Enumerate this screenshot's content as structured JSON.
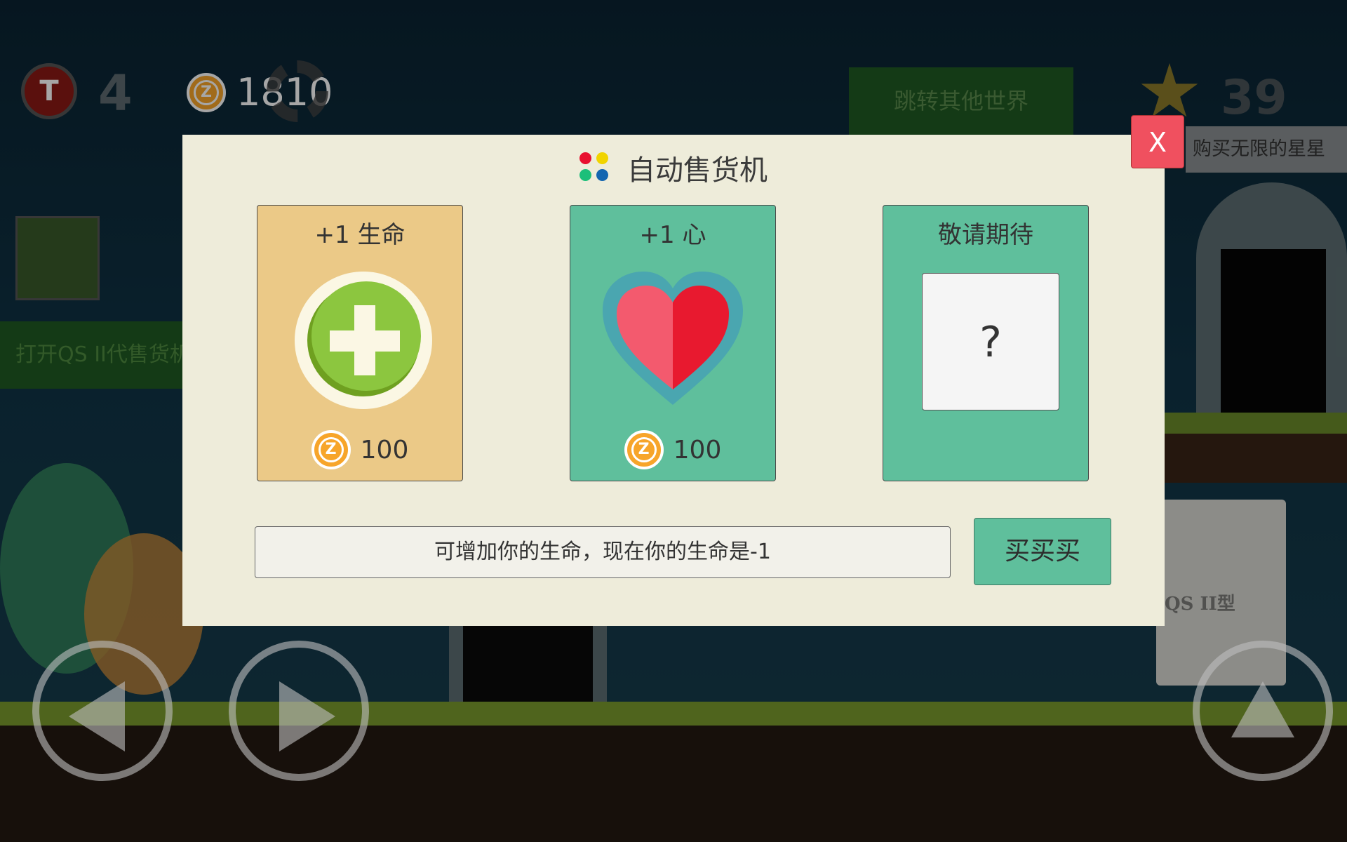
{
  "hud": {
    "lives_count": "4",
    "coins": "1810",
    "world_button": "跳转其他世界",
    "stars": "39",
    "buy_stars_label": "购买无限的星星",
    "vending_open_label": "打开QS II代售货机",
    "vending_machine_label": "QS II型"
  },
  "modal": {
    "title": "自动售货机",
    "close_label": "X",
    "description": "可增加你的生命，现在你的生命是-1",
    "buy_button": "买买买",
    "items": [
      {
        "title": "+1 生命",
        "price": "100",
        "icon": "plus-icon",
        "color": "#ebc987"
      },
      {
        "title": "+1 心",
        "price": "100",
        "icon": "heart-icon",
        "color": "#5fbf9c"
      },
      {
        "title": "敬请期待",
        "placeholder": "?",
        "icon": "question-icon",
        "color": "#5fbf9c"
      }
    ]
  },
  "colors": {
    "modal_bg": "#eeecda",
    "teal": "#5fbf9c",
    "gold": "#ebc987",
    "close": "#f0505f",
    "coin": "#f7a52a",
    "world_button": "#2a7a2a"
  }
}
